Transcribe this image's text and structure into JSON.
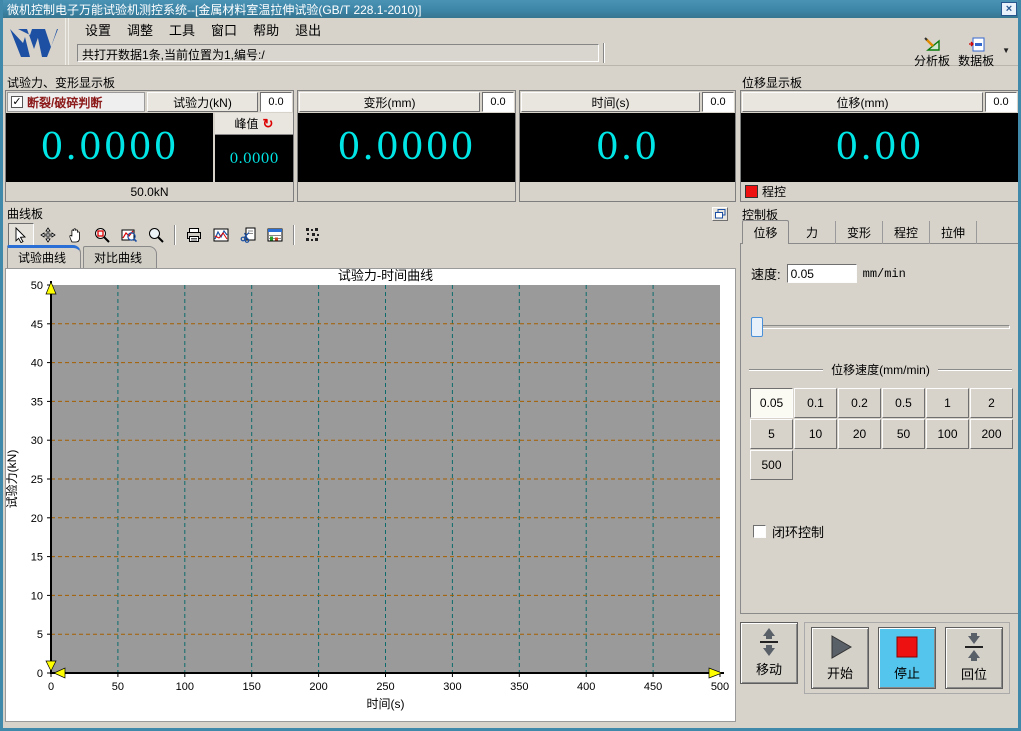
{
  "window": {
    "title": "微机控制电子万能试验机测控系统--[金属材料室温拉伸试验(GB/T 228.1-2010)]",
    "close_glyph": "×"
  },
  "menu": {
    "items": [
      "设置",
      "调整",
      "工具",
      "窗口",
      "帮助",
      "退出"
    ]
  },
  "statusbar": {
    "text": "共打开数据1条,当前位置为1,编号:/"
  },
  "topbar_buttons": {
    "analyze": "分析板",
    "databoard": "数据板",
    "dropdown_glyph": "▼"
  },
  "force_panel": {
    "title": "试验力、变形显示板",
    "break_check": {
      "checked": true,
      "glyph": "✓",
      "label": "断裂/破碎判断"
    },
    "force_group": {
      "name": "试验力(kN)",
      "aux": "0.0",
      "value": "0.0000",
      "peak_label": "峰值",
      "peak_refresh_glyph": "↻",
      "peak_value": "0.0000",
      "footer": "50.0kN"
    },
    "deform_group": {
      "name": "变形(mm)",
      "aux": "0.0",
      "value": "0.0000",
      "footer": ""
    },
    "time_group": {
      "name": "时间(s)",
      "aux": "0.0",
      "value": "0.0",
      "footer": ""
    }
  },
  "disp_panel": {
    "title": "位移显示板",
    "group": {
      "name": "位移(mm)",
      "aux": "0.0",
      "value": "0.00",
      "footer": "程控"
    }
  },
  "curve_panel": {
    "title": "曲线板",
    "tabs": [
      "试验曲线",
      "对比曲线"
    ],
    "toolbar_icons": [
      "cursor-icon",
      "move-cross-icon",
      "pan-hand-icon",
      "zoom-box-icon",
      "zoom-curve-icon",
      "magnifier-icon",
      "printer-icon",
      "curve-style-icon",
      "snip-page-icon",
      "data-table-icon",
      "barcode-icon"
    ],
    "restore_icon": "restore-window-icon"
  },
  "chart_data": {
    "type": "line",
    "title": "试验力-时间曲线",
    "xlabel": "时间(s)",
    "ylabel": "试验力(kN)",
    "xlim": [
      0,
      500
    ],
    "ylim": [
      0,
      50
    ],
    "xtick_step": 50,
    "ytick_step": 5,
    "grid": true,
    "legend": "none",
    "series": [
      {
        "name": "试验力-时间",
        "x": [],
        "y": []
      }
    ],
    "plot_bg": "#9a9a9a",
    "hgrid_color": "#a55f00",
    "vgrid_color": "#0d6b6b",
    "axis_color": "#000000",
    "arrow_color": "#ffff00"
  },
  "control_panel": {
    "title": "控制板",
    "tabs": [
      "位移",
      "力",
      "变形",
      "程控",
      "拉伸"
    ],
    "active_tab": "位移",
    "speed_label": "速度:",
    "speed_value": "0.05",
    "speed_unit": "mm/min",
    "speed_group": {
      "title": "位移速度(mm/min)",
      "options": [
        "0.05",
        "0.1",
        "0.2",
        "0.5",
        "1",
        "2",
        "5",
        "10",
        "20",
        "50",
        "100",
        "200",
        "500"
      ],
      "selected": "0.05"
    },
    "closed_loop": {
      "checked": false,
      "label": "闭环控制"
    },
    "buttons": {
      "move": "移动",
      "start": "开始",
      "stop": "停止",
      "home": "回位"
    }
  },
  "colors": {
    "titlebar": "#3e86a8",
    "display_digits": "#00e5e5",
    "break_label": "#8c1a1a",
    "stop_button_bg": "#54c6ed",
    "indicator_red": "#ee1111",
    "active_tab_accent": "#2a6fd6"
  }
}
